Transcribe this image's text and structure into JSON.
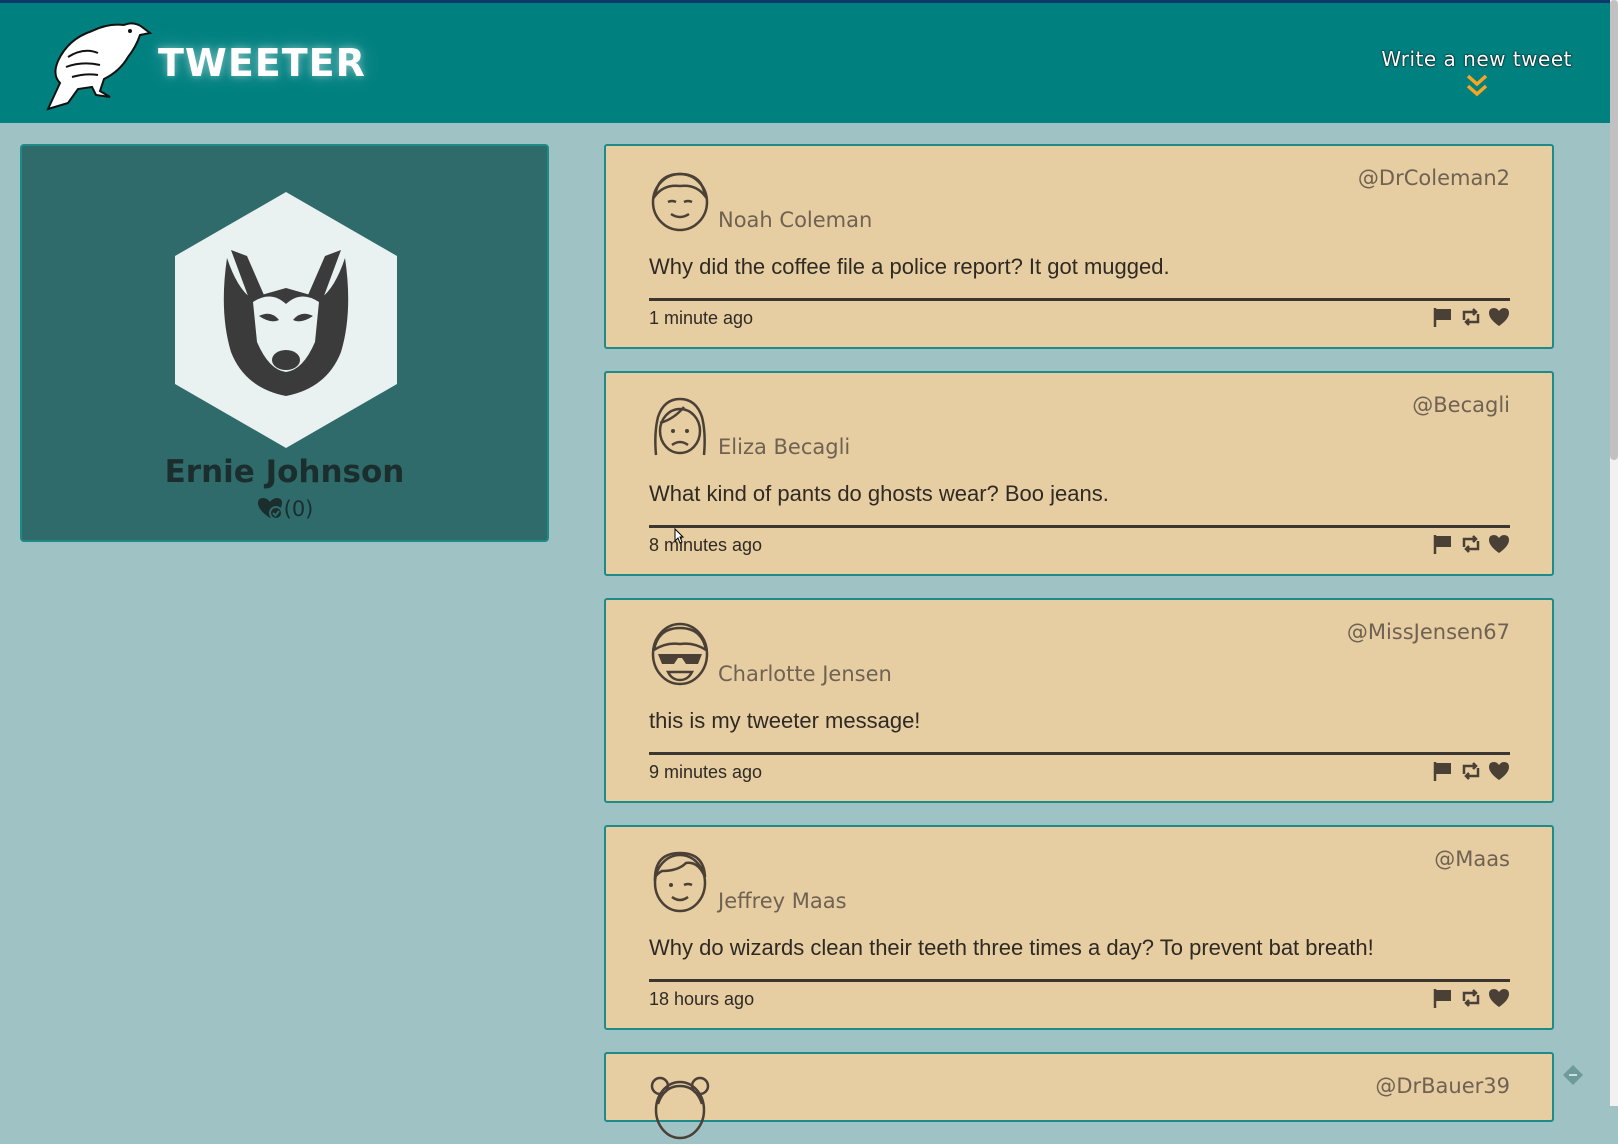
{
  "header": {
    "logo_text": "TWEETER",
    "compose_label": "Write a new tweet",
    "compose_icon": "double-chevron-down-icon",
    "accent_color": "#f5a623"
  },
  "profile": {
    "name": "Ernie Johnson",
    "likes": "(0)",
    "avatar": "husky-icon"
  },
  "tweets": [
    {
      "name": "Noah Coleman",
      "handle": "@DrColeman2",
      "text": "Why did the coffee file a police report? It got mugged.",
      "time": "1 minute ago",
      "avatar": "smiling-man-icon"
    },
    {
      "name": "Eliza Becagli",
      "handle": "@Becagli",
      "text": "What kind of pants do ghosts wear? Boo jeans.",
      "time": "8 minutes ago",
      "avatar": "frowning-woman-icon"
    },
    {
      "name": "Charlotte Jensen",
      "handle": "@MissJensen67",
      "text": "this is my tweeter message!",
      "time": "9 minutes ago",
      "avatar": "sunglasses-girl-icon"
    },
    {
      "name": "Jeffrey Maas",
      "handle": "@Maas",
      "text": "Why do wizards clean their teeth three times a day? To prevent bat breath!",
      "time": "18 hours ago",
      "avatar": "winking-man-icon"
    },
    {
      "handle": "@DrBauer39",
      "avatar": "pigtails-girl-icon"
    }
  ],
  "actions": [
    "flag-icon",
    "retweet-icon",
    "heart-icon"
  ]
}
